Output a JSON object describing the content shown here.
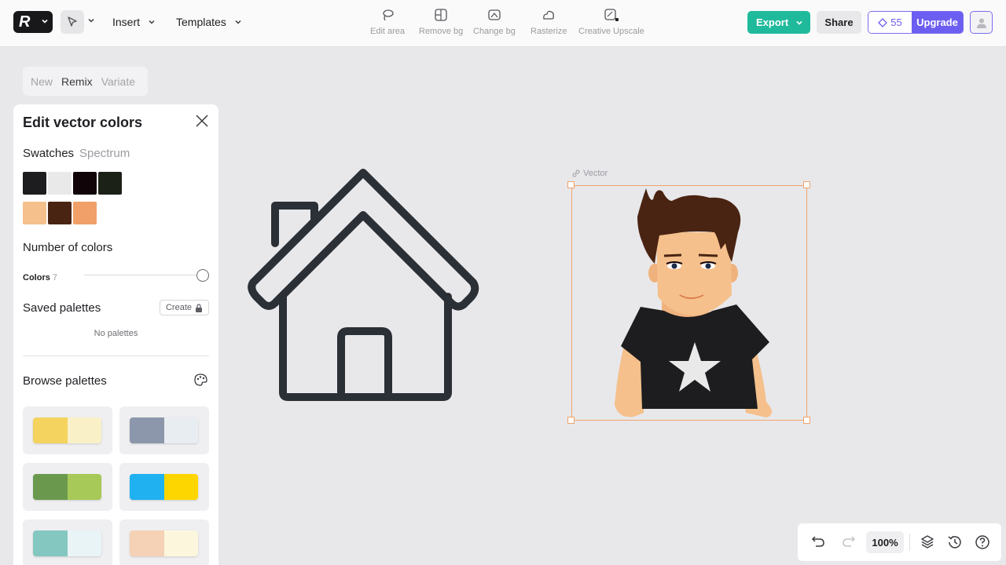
{
  "topbar": {
    "menus": [
      {
        "label": "Insert"
      },
      {
        "label": "Templates"
      }
    ],
    "tools": [
      {
        "label": "Edit area",
        "icon": "lasso-icon"
      },
      {
        "label": "Remove bg",
        "icon": "remove-bg-icon"
      },
      {
        "label": "Change bg",
        "icon": "change-bg-icon"
      },
      {
        "label": "Rasterize",
        "icon": "rasterize-icon"
      },
      {
        "label": "Creative Upscale",
        "icon": "upscale-icon"
      }
    ],
    "export_label": "Export",
    "share_label": "Share",
    "credits": "55",
    "upgrade_label": "Upgrade",
    "accent": "#6c5ef0",
    "export_color": "#1fba9c"
  },
  "mode_tabs": [
    {
      "label": "New",
      "active": false
    },
    {
      "label": "Remix",
      "active": true
    },
    {
      "label": "Variate",
      "active": false
    }
  ],
  "panel": {
    "title": "Edit vector colors",
    "tabs": {
      "swatches": "Swatches",
      "spectrum": "Spectrum"
    },
    "swatches": [
      "#1d1d1f",
      "#e9e9ea",
      "#110409",
      "#1c2118",
      "#f5c08c",
      "#4a2412",
      "#f0a068"
    ],
    "number_of_colors_heading": "Number of colors",
    "colors_label": "Colors",
    "colors_value": "7",
    "saved_palettes_heading": "Saved palettes",
    "create_label": "Create",
    "no_palettes": "No palettes",
    "browse_heading": "Browse palettes",
    "palettes": [
      [
        "#f4d35e",
        "#faf0c8"
      ],
      [
        "#8c97ab",
        "#e8edf1"
      ],
      [
        "#6a994e",
        "#a7c957"
      ],
      [
        "#1fb1f0",
        "#fdd600"
      ],
      [
        "#84c7c1",
        "#e9f4f7"
      ],
      [
        "#f5d1b5",
        "#fcf7dc"
      ]
    ]
  },
  "canvas": {
    "selection_label": "Vector"
  },
  "bottom": {
    "zoom": "100%"
  }
}
